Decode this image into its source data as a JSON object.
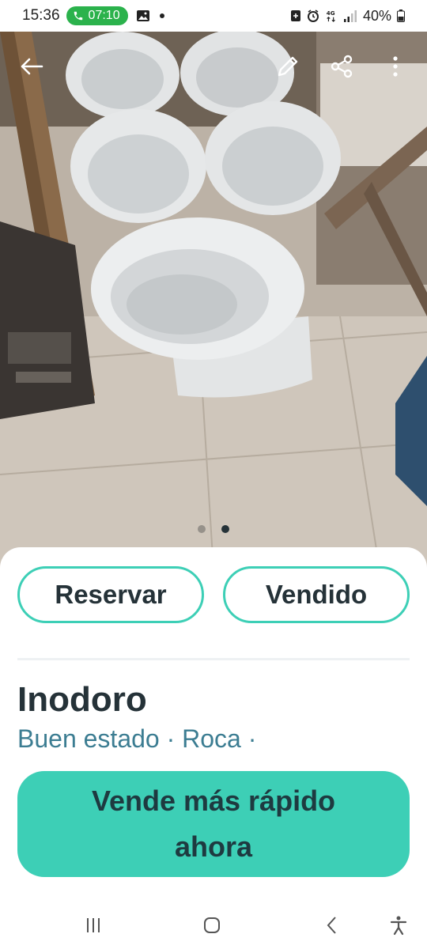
{
  "status_bar": {
    "time": "15:36",
    "call_timer": "07:10",
    "network": "4G",
    "battery": "40%"
  },
  "toolbar": {
    "back_icon": "arrow-left-icon",
    "edit_icon": "pencil-icon",
    "share_icon": "share-icon",
    "more_icon": "more-vertical-icon"
  },
  "carousel": {
    "total": 2,
    "active_index": 1
  },
  "actions": {
    "reserve_label": "Reservar",
    "sold_label": "Vendido"
  },
  "listing": {
    "title": "Inodoro",
    "subtitle": "Buen estado · Roca ·"
  },
  "promo": {
    "cta_label": "Vende más rápido ahora"
  },
  "colors": {
    "accent": "#3dcfb6",
    "text_dark": "#253238",
    "subtitle": "#3c7d92",
    "call_green": "#2bb24c"
  }
}
